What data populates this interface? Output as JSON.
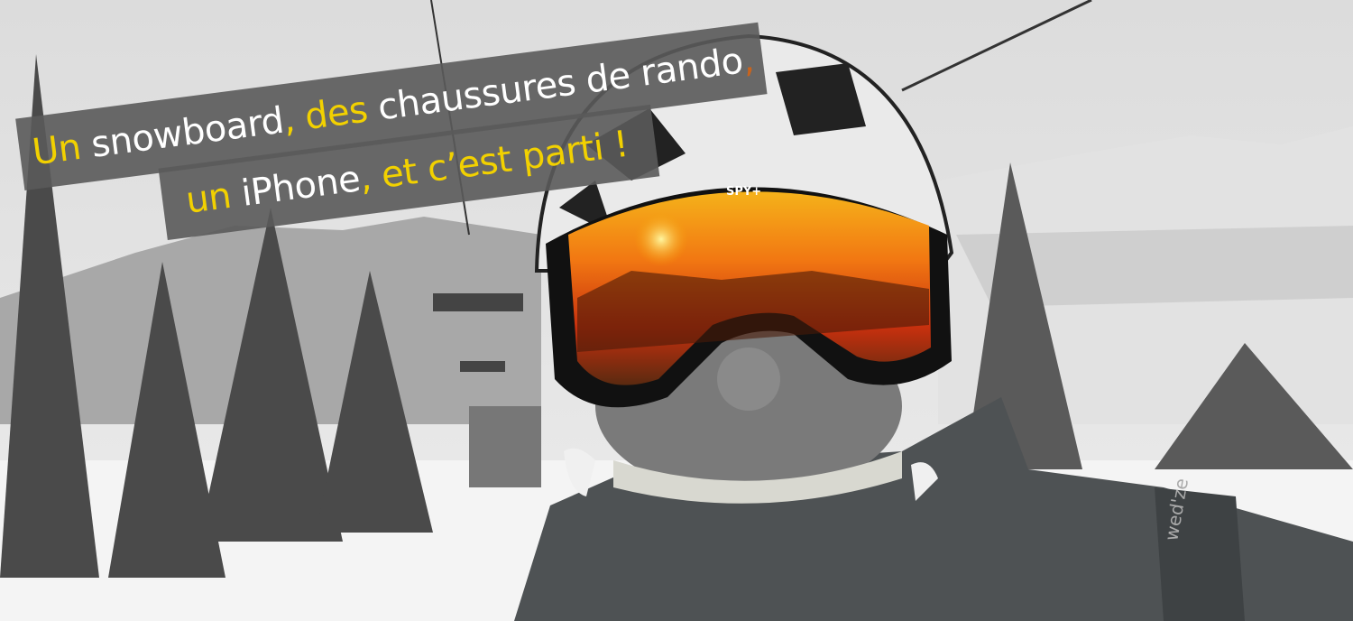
{
  "banner": {
    "lines": [
      {
        "segments": [
          {
            "text": "Un",
            "color": "#f2d100"
          },
          {
            "text": " snowboard",
            "color": "#ffffff"
          },
          {
            "text": ", des",
            "color": "#f2d100"
          },
          {
            "text": " chaussures de rando",
            "color": "#ffffff"
          },
          {
            "text": ",",
            "color": "#c8641e"
          }
        ]
      },
      {
        "segments": [
          {
            "text": "un",
            "color": "#f2d100"
          },
          {
            "text": " iPhone",
            "color": "#ffffff"
          },
          {
            "text": ", et c’est parti !",
            "color": "#f2d100"
          }
        ]
      }
    ]
  },
  "photo": {
    "goggle_brand": "SPY+",
    "jacket_logo": "wed'ze"
  },
  "colors": {
    "accent_yellow": "#f2d100",
    "banner_bg": "#5a5a5a",
    "goggle_orange": "#f07a10"
  }
}
